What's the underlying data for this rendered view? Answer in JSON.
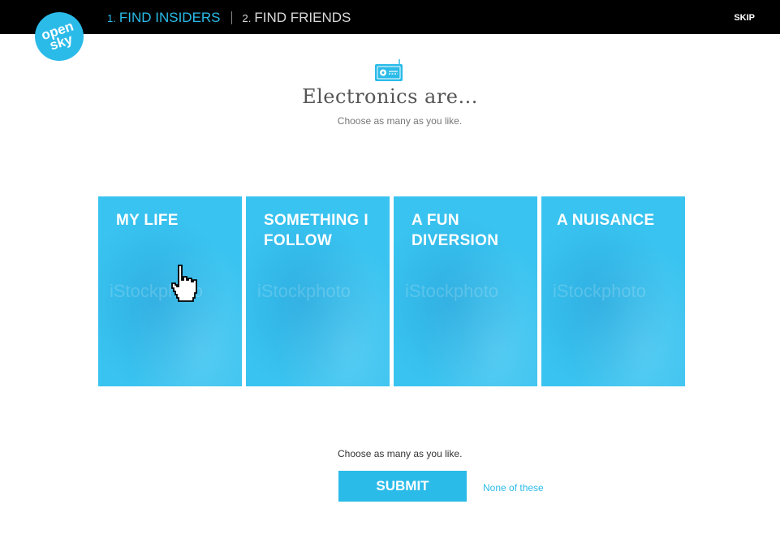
{
  "header": {
    "logo_line1": "open",
    "logo_line2": "sky",
    "step1_num": "1.",
    "step1_label": "FIND INSIDERS",
    "step2_num": "2.",
    "step2_label": "FIND FRIENDS",
    "skip_label": "SKIP"
  },
  "main": {
    "category_icon": "radio-icon",
    "heading": "Electronics are...",
    "subheading": "Choose as many as you like."
  },
  "cards": [
    {
      "label": "MY LIFE",
      "watermark": "iStockphoto"
    },
    {
      "label": "SOMETHING I FOLLOW",
      "watermark": "iStockphoto"
    },
    {
      "label": "A FUN DIVERSION",
      "watermark": "iStockphoto"
    },
    {
      "label": "A NUISANCE",
      "watermark": "iStockphoto"
    }
  ],
  "footer": {
    "instruction": "Choose as many as you like.",
    "submit_label": "SUBMIT",
    "none_label": "None of these"
  },
  "colors": {
    "accent": "#2bbbe9",
    "card": "#39c3f0",
    "header_bg": "#000000"
  }
}
